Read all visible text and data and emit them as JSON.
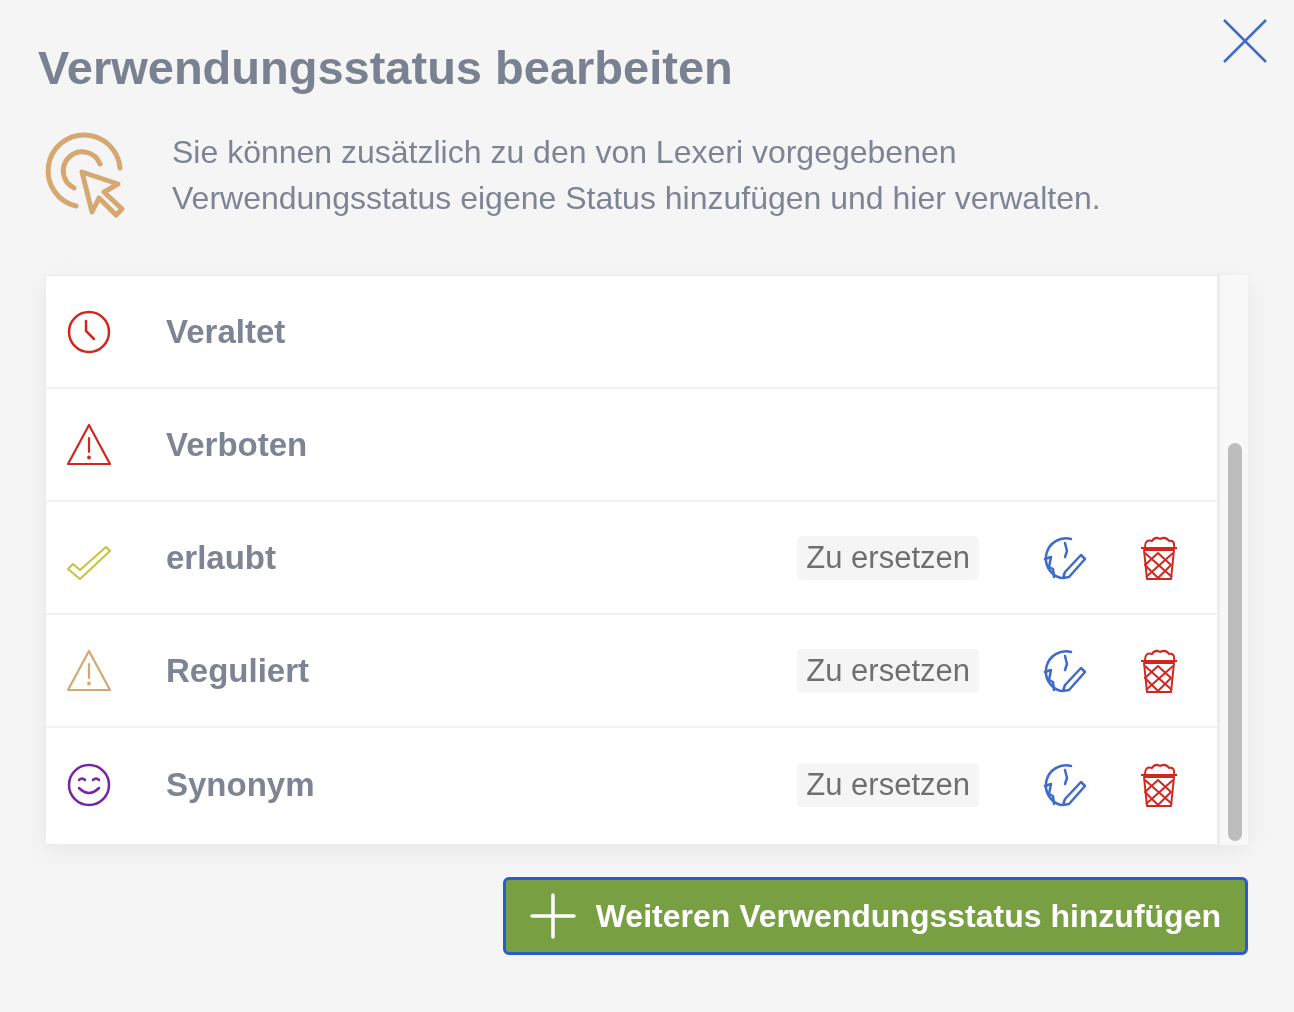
{
  "dialog": {
    "title": "Verwendungsstatus bearbeiten",
    "description": "Sie können zusätzlich zu den von Lexeri vorgegebenen Verwendungsstatus eigene Status hinzufügen und hier verwalten."
  },
  "statuses": [
    {
      "kind": "clock",
      "color": "#d0281e",
      "label": "Veraltet",
      "editable": false
    },
    {
      "kind": "warning",
      "color": "#d0281e",
      "label": "Verboten",
      "editable": false
    },
    {
      "kind": "check",
      "color": "#c9c23a",
      "label": "erlaubt",
      "tag": "Zu ersetzen",
      "editable": true
    },
    {
      "kind": "warning",
      "color": "#d4a870",
      "label": "Reguliert",
      "tag": "Zu ersetzen",
      "editable": true
    },
    {
      "kind": "smile",
      "color": "#7a22a6",
      "label": "Synonym",
      "tag": "Zu ersetzen",
      "editable": true
    }
  ],
  "add_button": {
    "label": "Weiteren Verwendungsstatus hinzufügen"
  }
}
